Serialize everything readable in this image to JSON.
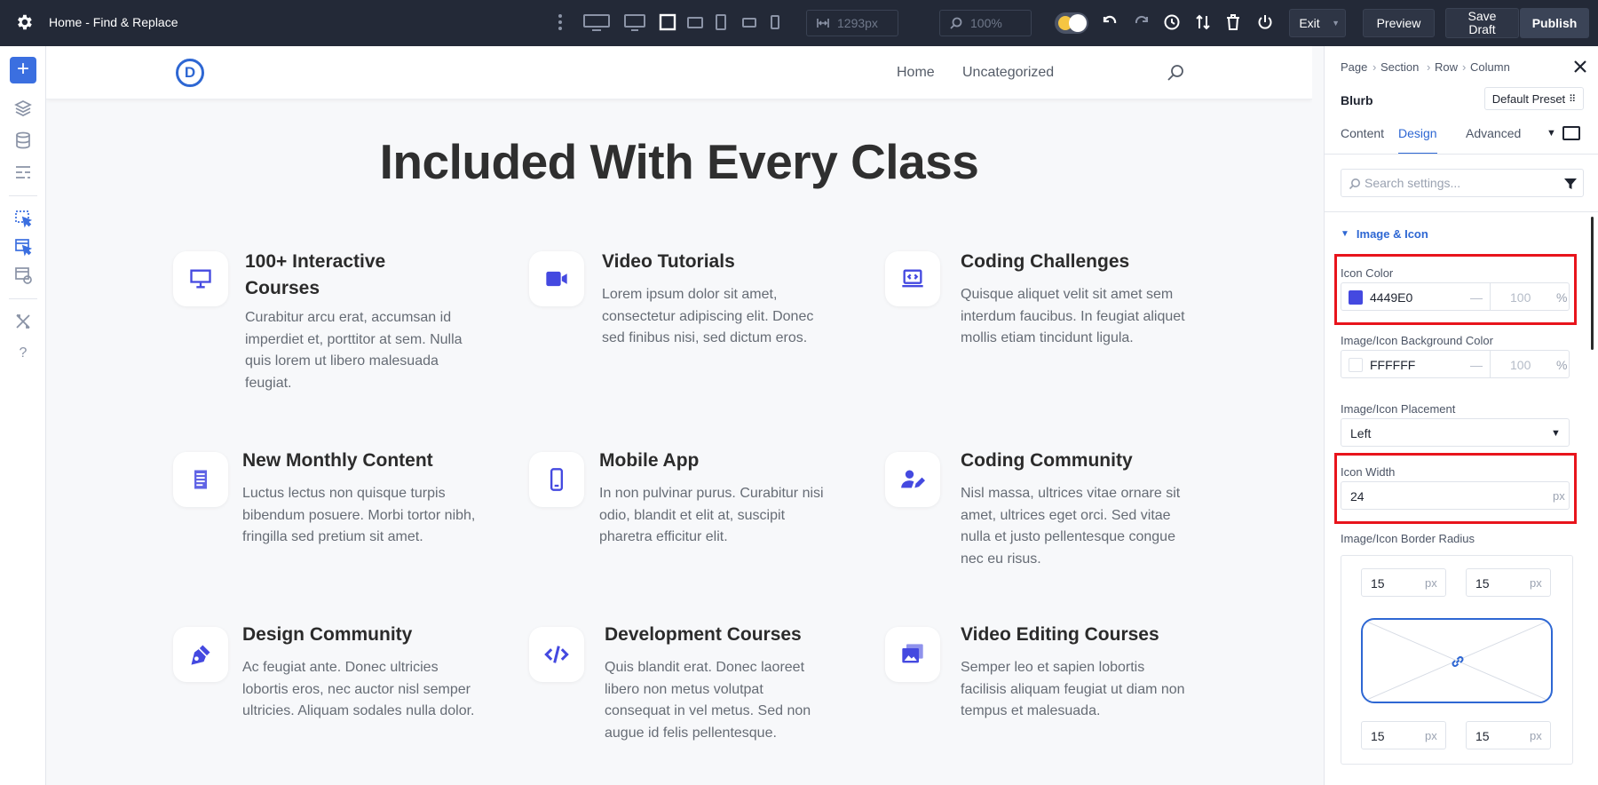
{
  "topbar": {
    "page_title": "Home - Find & Replace",
    "width_value": "1293px",
    "zoom_value": "100%",
    "exit_label": "Exit",
    "preview_label": "Preview",
    "save_draft_label": "Save Draft",
    "publish_label": "Publish",
    "icons": [
      "gear-icon",
      "more-icon",
      "desktop-large-icon",
      "desktop-icon",
      "laptop-icon",
      "tablet-landscape-icon",
      "tablet-icon",
      "phone-landscape-icon",
      "phone-icon",
      "width-icon",
      "zoom-icon",
      "undo-icon",
      "redo-icon",
      "history-icon",
      "sort-icon",
      "trash-icon",
      "power-icon"
    ]
  },
  "leftrail": {
    "icons": [
      "add-icon",
      "layers-icon",
      "database-icon",
      "layout-icon",
      "select-element-icon",
      "select-multiple-icon",
      "responsive-icon",
      "tools-icon",
      "help-icon"
    ]
  },
  "site": {
    "logo_letter": "D",
    "nav": [
      "Home",
      "Uncategorized"
    ],
    "section_title": "Included With Every Class",
    "blurbs": [
      {
        "title": "100+ Interactive Courses",
        "text": "Curabitur arcu erat, accumsan id imperdiet et, porttitor at sem. Nulla quis lorem ut libero malesuada feugiat.",
        "icon": "desktop-icon"
      },
      {
        "title": "Video Tutorials",
        "text": "Lorem ipsum dolor sit amet, consectetur adipiscing elit. Donec sed finibus nisi, sed dictum eros.",
        "icon": "video-camera-icon"
      },
      {
        "title": "Coding Challenges",
        "text": "Quisque aliquet velit sit amet sem interdum faucibus. In feugiat aliquet mollis etiam tincidunt ligula.",
        "icon": "laptop-code-icon"
      },
      {
        "title": "New Monthly Content",
        "text": "Luctus lectus non quisque turpis bibendum posuere. Morbi tortor nibh, fringilla sed pretium sit amet.",
        "icon": "document-icon"
      },
      {
        "title": "Mobile App",
        "text": "In non pulvinar purus. Curabitur nisi odio, blandit et elit at, suscipit pharetra efficitur elit.",
        "icon": "mobile-phone-icon"
      },
      {
        "title": "Coding Community",
        "text": "Nisl massa, ultrices vitae ornare sit amet, ultrices eget orci. Sed vitae nulla et justo pellentesque congue nec eu risus.",
        "icon": "user-edit-icon"
      },
      {
        "title": "Design Community",
        "text": "Ac feugiat ante. Donec ultricies lobortis eros, nec auctor nisl semper ultricies. Aliquam sodales nulla dolor.",
        "icon": "pen-nib-icon"
      },
      {
        "title": "Development Courses",
        "text": "Quis blandit erat. Donec laoreet libero non metus volutpat consequat in vel metus. Sed non augue id felis pellentesque.",
        "icon": "code-icon"
      },
      {
        "title": "Video Editing Courses",
        "text": "Semper leo et sapien lobortis facilisis aliquam feugiat ut diam non tempus et malesuada.",
        "icon": "photo-video-icon"
      }
    ]
  },
  "panel": {
    "breadcrumb": [
      "Page",
      "Section",
      "Row",
      "Column"
    ],
    "module_name": "Blurb",
    "preset_label": "Default Preset",
    "tabs": [
      "Content",
      "Design",
      "Advanced"
    ],
    "active_tab": "Design",
    "search_placeholder": "Search settings...",
    "group_title": "Image & Icon",
    "icon_color": {
      "label": "Icon Color",
      "hex": "4449E0",
      "swatch": "#4449E0",
      "opacity_placeholder": "100",
      "unit": "%"
    },
    "icon_bg_color": {
      "label": "Image/Icon Background Color",
      "hex": "FFFFFF",
      "swatch": "#FFFFFF",
      "opacity_placeholder": "100",
      "unit": "%"
    },
    "placement": {
      "label": "Image/Icon Placement",
      "value": "Left"
    },
    "icon_width": {
      "label": "Icon Width",
      "value": "24",
      "unit": "px"
    },
    "border_radius": {
      "label": "Image/Icon Border Radius",
      "top_left": "15",
      "top_right": "15",
      "bottom_left": "15",
      "bottom_right": "15",
      "unit": "px"
    }
  },
  "colors": {
    "accent": "#2e67d3",
    "icon": "#4449E0",
    "highlight": "#e8141c",
    "topbar": "#232937"
  }
}
